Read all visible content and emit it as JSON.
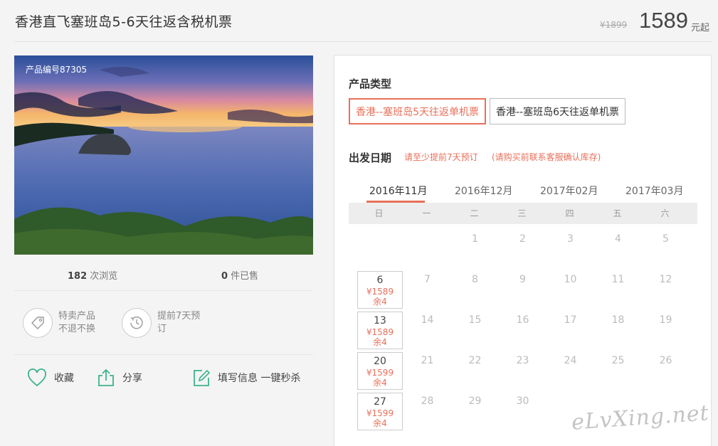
{
  "header": {
    "title": "香港直飞塞班岛5-6天往返含税机票",
    "old_price": "¥1899",
    "price": "1589",
    "price_unit": "元起"
  },
  "product": {
    "number_label": "产品编号87305",
    "views_count": "182",
    "views_label": " 次浏览",
    "sold_count": "0",
    "sold_label": " 件已售"
  },
  "features": [
    {
      "icon": "tag-icon",
      "text": "特卖产品不退不换"
    },
    {
      "icon": "clock-icon",
      "text": "提前7天预订"
    }
  ],
  "actions": {
    "favorite": "收藏",
    "share": "分享",
    "quick_order": "填写信息 一键秒杀"
  },
  "booking": {
    "type_label": "产品类型",
    "types": [
      "香港--塞班岛5天往返单机票",
      "香港--塞班岛6天往返单机票"
    ],
    "date_label": "出发日期",
    "notice1": "请至少提前7天预订",
    "notice2": "(请购买前联系客服确认库存)",
    "months": [
      "2016年11月",
      "2016年12月",
      "2017年02月",
      "2017年03月"
    ],
    "weekdays": [
      "日",
      "一",
      "二",
      "三",
      "四",
      "五",
      "六"
    ],
    "available": [
      {
        "day": "6",
        "price": "¥1589",
        "stock": "余4"
      },
      {
        "day": "13",
        "price": "¥1589",
        "stock": "余4"
      },
      {
        "day": "20",
        "price": "¥1599",
        "stock": "余4"
      },
      {
        "day": "27",
        "price": "¥1599",
        "stock": "余4"
      }
    ],
    "days": [
      "1",
      "2",
      "3",
      "4",
      "5",
      "7",
      "8",
      "9",
      "10",
      "11",
      "12",
      "14",
      "15",
      "16",
      "17",
      "18",
      "19",
      "21",
      "22",
      "23",
      "24",
      "25",
      "26",
      "28",
      "29",
      "30"
    ]
  },
  "watermark": "eLvXing.net",
  "colors": {
    "accent": "#e8705a",
    "green": "#3cb48c"
  }
}
